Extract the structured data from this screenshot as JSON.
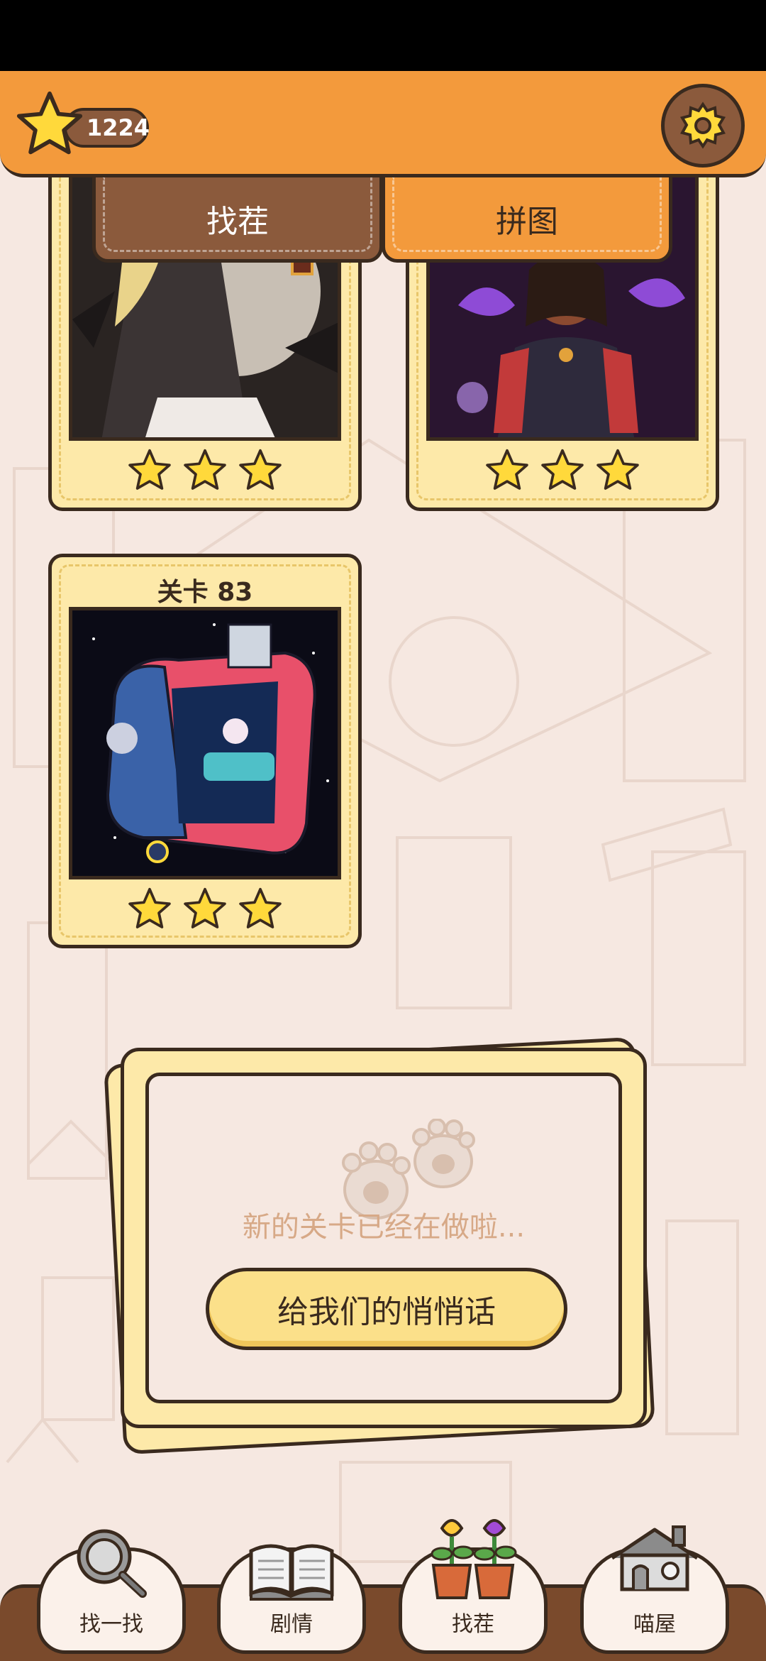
{
  "header": {
    "star_count": "1224"
  },
  "tabs": {
    "find": "找茬",
    "puzzle": "拼图"
  },
  "cards": [
    {
      "stars": 3
    },
    {
      "stars": 3
    },
    {
      "title": "关卡 83",
      "stars": 3
    }
  ],
  "panel": {
    "message": "新的关卡已经在做啦...",
    "button": "给我们的悄悄话"
  },
  "nav": {
    "items": [
      {
        "label": "找一找",
        "icon": "magnifier-icon"
      },
      {
        "label": "剧情",
        "icon": "book-icon"
      },
      {
        "label": "找茬",
        "icon": "flower-pots-icon"
      },
      {
        "label": "喵屋",
        "icon": "house-icon"
      }
    ]
  },
  "colors": {
    "orange": "#f39a3c",
    "brown": "#8b5a3c",
    "cream": "#fde9a9",
    "star": "#ffd93b"
  }
}
